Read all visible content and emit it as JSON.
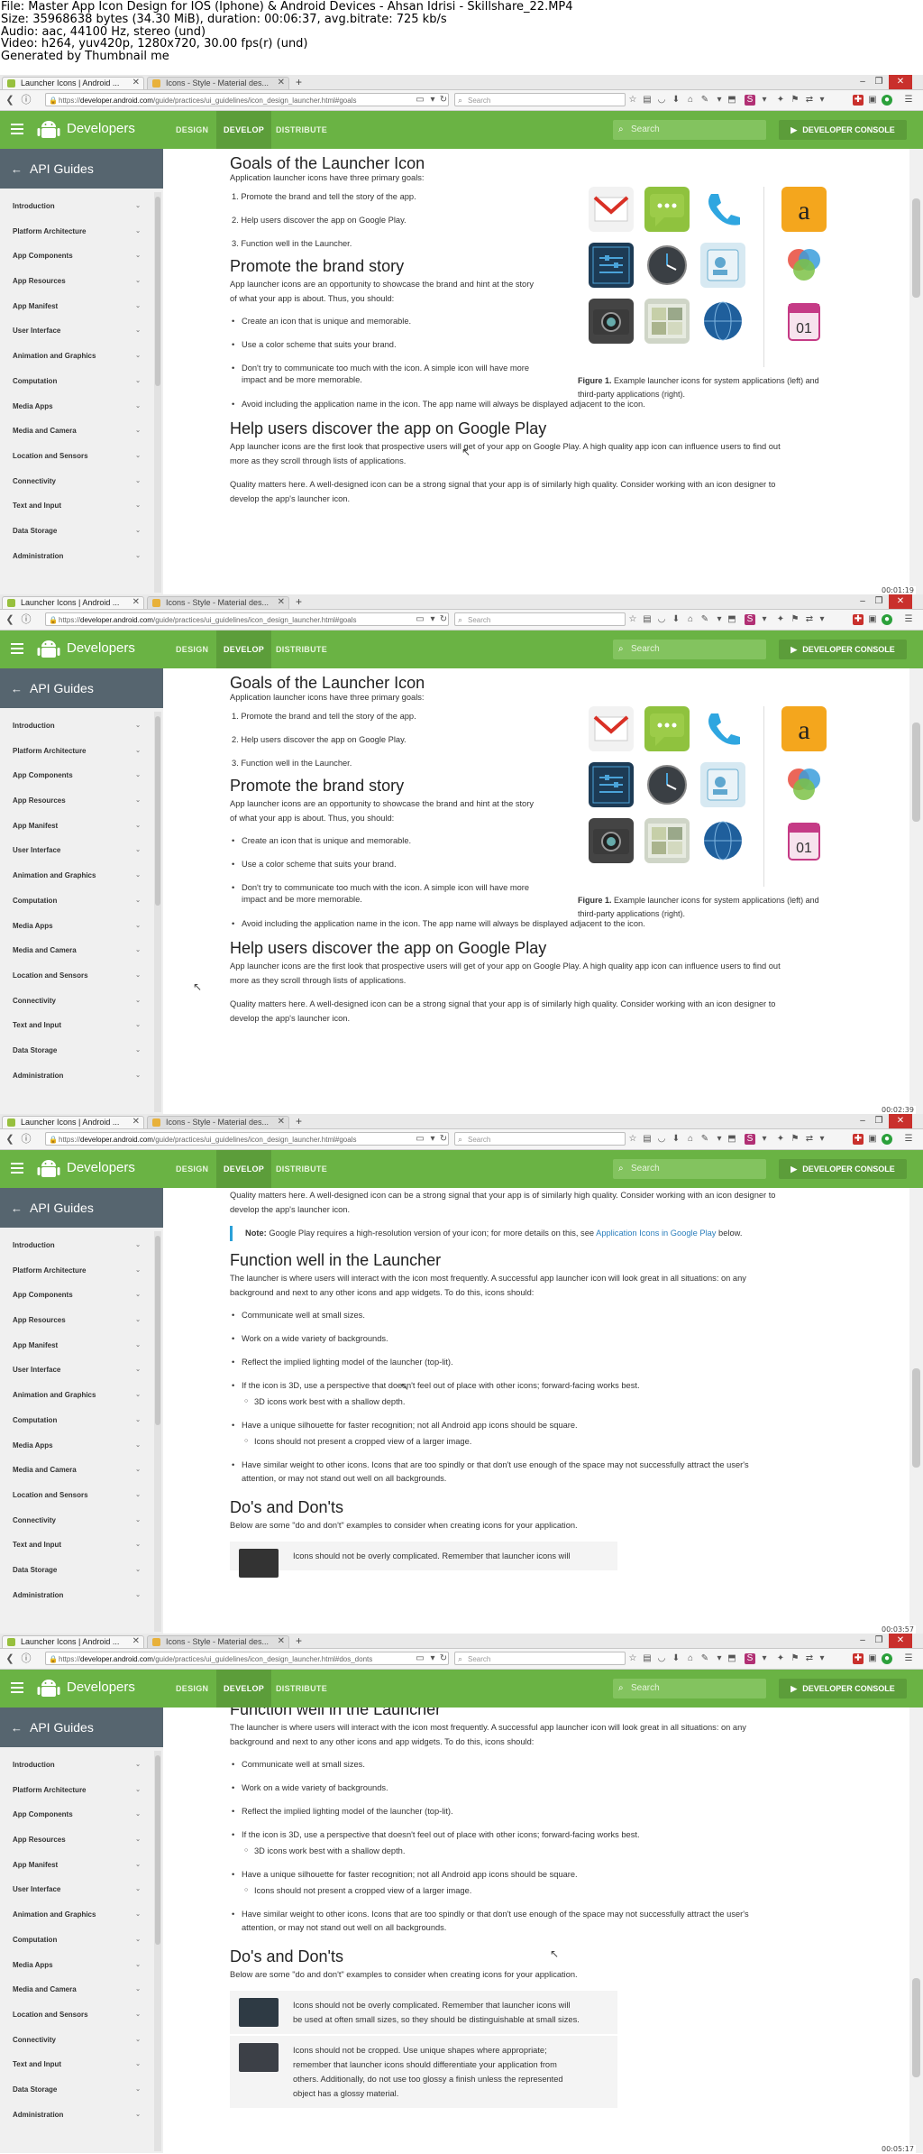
{
  "sheet_header": {
    "line1": "File: Master App Icon Design for IOS (Iphone) & Android Devices - Ahsan Idrisi - Skillshare_22.MP4",
    "line2": "Size: 35968638 bytes (34.30 MiB), duration: 00:06:37, avg.bitrate: 725 kb/s",
    "line3": "Audio: aac, 44100 Hz, stereo (und)",
    "line4": "Video: h264, yuv420p, 1280x720, 30.00 fps(r) (und)",
    "line5": "Generated by Thumbnail me"
  },
  "browser": {
    "tab1": "Launcher Icons | Android ...",
    "tab2": "Icons - Style - Material des...",
    "url_prefix": "https://",
    "url_domain": "developer.android.com",
    "url_path_goals": "/guide/practices/ui_guidelines/icon_design_launcher.html#goals",
    "url_path_dos": "/guide/practices/ui_guidelines/icon_design_launcher.html#dos_donts",
    "search_placeholder": "Search"
  },
  "site": {
    "brand": "Developers",
    "nav_design": "DESIGN",
    "nav_develop": "DEVELOP",
    "nav_distribute": "DISTRIBUTE",
    "search_placeholder": "Search",
    "console": "DEVELOPER CONSOLE",
    "accent": "#6ab344"
  },
  "sidebar": {
    "title": "API Guides",
    "items": [
      "Introduction",
      "Platform Architecture",
      "App Components",
      "App Resources",
      "App Manifest",
      "User Interface",
      "Animation and Graphics",
      "Computation",
      "Media Apps",
      "Media and Camera",
      "Location and Sensors",
      "Connectivity",
      "Text and Input",
      "Data Storage",
      "Administration"
    ]
  },
  "content": {
    "goals_title": "Goals of the Launcher Icon",
    "goals_intro": "Application launcher icons have three primary goals:",
    "goals_list": [
      "1.  Promote the brand and tell the story of the app.",
      "2.  Help users discover the app on Google Play.",
      "3.  Function well in the Launcher."
    ],
    "brand_title": "Promote the brand story",
    "brand_p1": "App launcher icons are an opportunity to showcase the brand and hint at the story",
    "brand_p2": "of what your app is about. Thus, you should:",
    "brand_list": [
      "Create an icon that is unique and memorable.",
      "Use a color scheme that suits your brand.",
      "Don't try to communicate too much with the icon. A simple icon will have more",
      "impact and be more memorable.",
      "Avoid including the application name in the icon. The app name will always be displayed adjacent to the icon."
    ],
    "figure_label": "Figure 1.",
    "figure_caption_a": " Example launcher icons for system applications (left) and",
    "figure_caption_b": "third-party applications (right).",
    "discover_title": "Help users discover the app on Google Play",
    "discover_p1": "App launcher icons are the first look that prospective users will get of your app on Google Play. A high quality app icon can influence users to find out",
    "discover_p2": "more as they scroll through lists of applications.",
    "quality_p1": "Quality matters here. A well-designed icon can be a strong signal that your app is of similarly high quality. Consider working with an icon designer to",
    "quality_p2": "develop the app's launcher icon.",
    "note_label": "Note:",
    "note_text": " Google Play requires a high-resolution version of your icon; for more details on this, see ",
    "note_link": "Application Icons in Google Play",
    "note_end": " below.",
    "function_title": "Function well in the Launcher",
    "function_p1": "The launcher is where users will interact with the icon most frequently. A successful app launcher icon will look great in all situations: on any",
    "function_p2": "background and next to any other icons and app widgets. To do this, icons should:",
    "function_list": [
      "Communicate well at small sizes.",
      "Work on a wide variety of backgrounds.",
      "Reflect the implied lighting model of the launcher (top-lit).",
      "If the icon is 3D, use a perspective that doesn't feel out of place with other icons; forward-facing works best.",
      "3D icons work best with a shallow depth.",
      "Have a unique silhouette for faster recognition; not all Android app icons should be square.",
      "Icons should not present a cropped view of a larger image.",
      "Have similar weight to other icons. Icons that are too spindly or that don't use enough of the space may not successfully attract the user's",
      "attention, or may not stand out well on all backgrounds."
    ],
    "dos_title": "Do's and Don'ts",
    "dos_intro": "Below are some \"do and don't\" examples to consider when creating icons for your application.",
    "dos_item1a": "Icons should not be overly complicated. Remember that launcher icons will",
    "dos_item1b": "be used at often small sizes, so they should be distinguishable at small sizes.",
    "dos_item2a": "Icons should not be cropped. Use unique shapes where appropriate;",
    "dos_item2b": "remember that launcher icons should differentiate your application from",
    "dos_item2c": "others. Additionally, do not use too glossy a finish unless the represented",
    "dos_item2d": "object has a glossy material."
  },
  "timestamps": [
    "00:01:19",
    "00:02:39",
    "00:03:57",
    "00:05:17"
  ]
}
